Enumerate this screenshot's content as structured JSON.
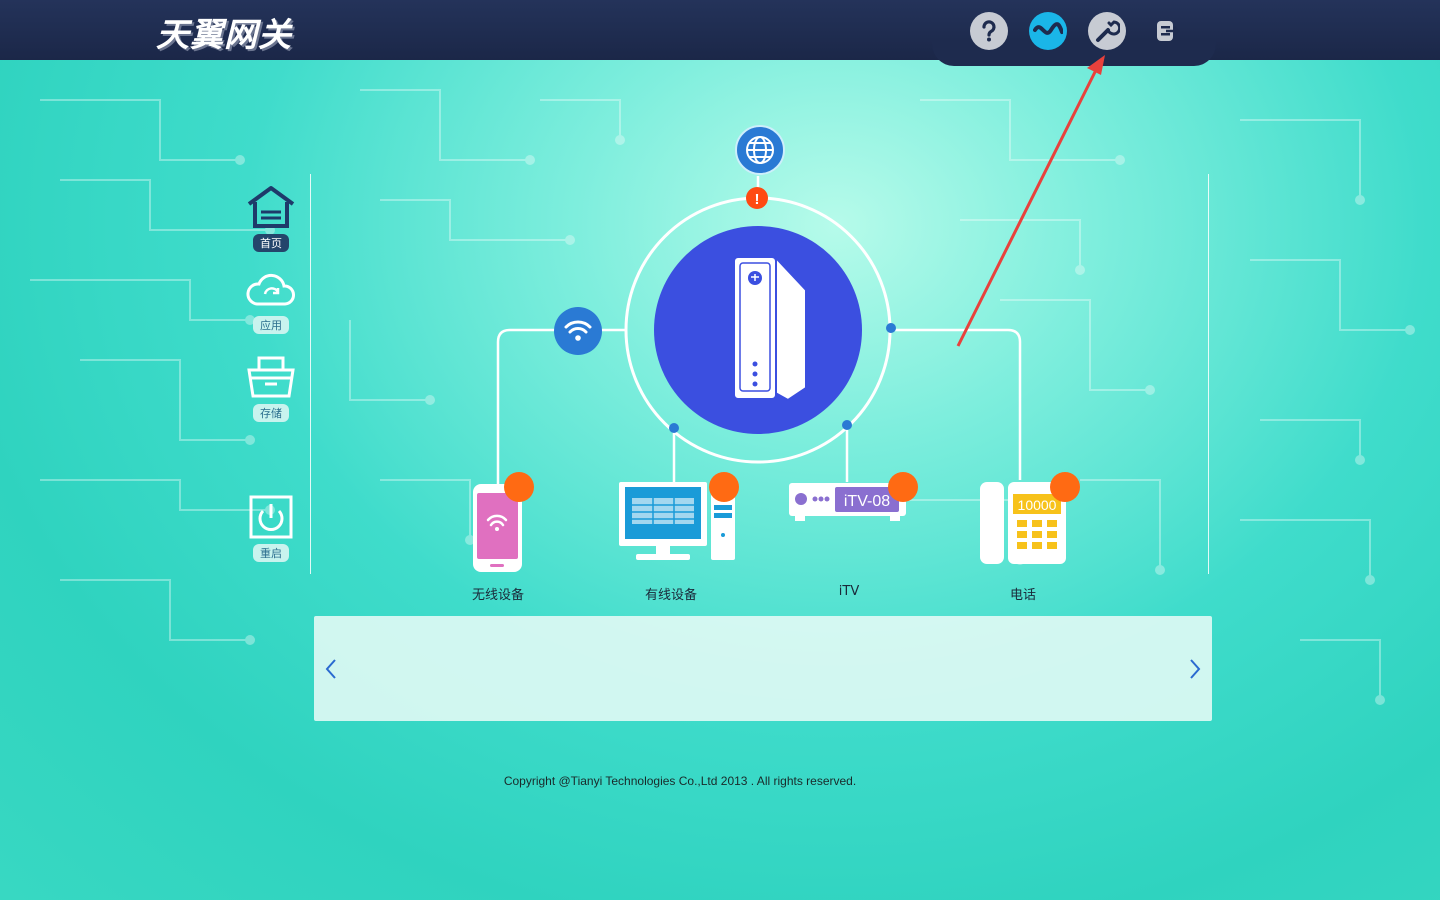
{
  "header": {
    "logo_text": "天翼网关",
    "icons": [
      "help-icon",
      "network-status-icon",
      "settings-wrench-icon",
      "logout-icon"
    ]
  },
  "sidebar": {
    "items": [
      {
        "label": "首页",
        "icon": "home-icon",
        "active": true
      },
      {
        "label": "应用",
        "icon": "cloud-refresh-icon",
        "active": false
      },
      {
        "label": "存储",
        "icon": "storage-basket-icon",
        "active": false
      },
      {
        "label": "重启",
        "icon": "power-icon",
        "active": false
      }
    ]
  },
  "topology": {
    "center_icon": "gateway-device-icon",
    "internet_icon": "globe-icon",
    "alert_symbol": "!",
    "wifi_icon": "wifi-icon",
    "devices": [
      {
        "label": "无线设备",
        "icon": "mobile-phone-icon"
      },
      {
        "label": "有线设备",
        "icon": "desktop-computer-icon"
      },
      {
        "label": "iTV",
        "icon": "settop-box-icon",
        "screen_text": "iTV-08"
      },
      {
        "label": "电话",
        "icon": "telephone-icon",
        "screen_text": "10000"
      }
    ]
  },
  "panel": {
    "prev_arrow": "‹",
    "next_arrow": "›"
  },
  "footer": {
    "copyright": "Copyright @Tianyi Technologies Co.,Ltd 2013 . All rights reserved."
  },
  "colors": {
    "topbar": "#1e2b4e",
    "accent_blue": "#3b4fe0",
    "status_blue": "#1ab6e8",
    "alert": "#ff4a12",
    "badge_orange": "#ff6a13",
    "annotation_red": "#e8413c"
  }
}
